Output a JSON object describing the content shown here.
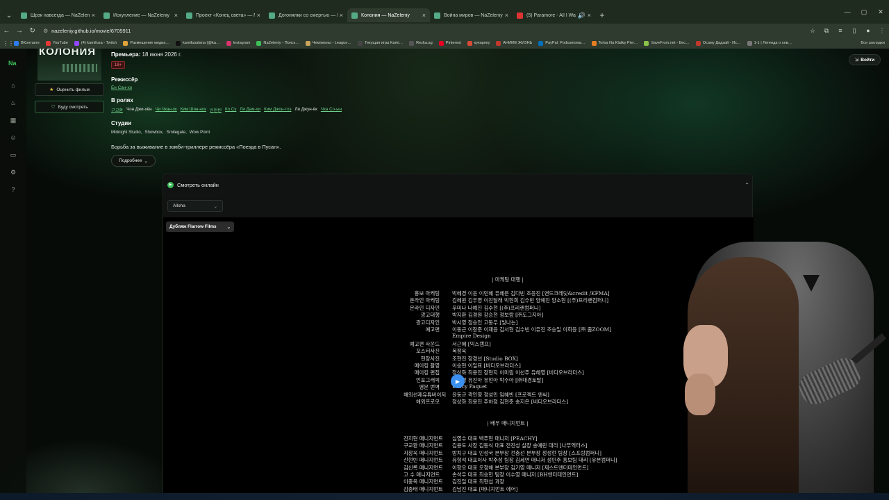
{
  "browser": {
    "tabs": [
      {
        "label": "Шрэк навсегда — NaZeleniy",
        "active": false
      },
      {
        "label": "Искупление — NaZeleniy",
        "active": false
      },
      {
        "label": "Проект «Конец света» — NaZ…",
        "active": false
      },
      {
        "label": "Догонялки со смертью — NaZ…",
        "active": false
      },
      {
        "label": "Колония — NaZeleniy",
        "active": true
      },
      {
        "label": "Война миров — NaZeleniy",
        "active": false
      },
      {
        "label": "(5) Paramore - All I Wanted",
        "active": false
      }
    ],
    "url": "nazeleniy.github.io/movie/6705911",
    "bookmarks": [
      {
        "label": "ВКонтакте",
        "color": "#2d7cf0"
      },
      {
        "label": "YouTube",
        "color": "#e53935"
      },
      {
        "label": "(4) kamifusa - Twitch",
        "color": "#9146ff"
      },
      {
        "label": "Размещение медиа…",
        "color": "#e0a33a"
      },
      {
        "label": "kamifusalana (@ka…",
        "color": "#111111"
      },
      {
        "label": "Instagram",
        "color": "#d6336c"
      },
      {
        "label": "NaZeleniy - Поиск…",
        "color": "#3fbf5a"
      },
      {
        "label": "Чемпионы - League…",
        "color": "#c9a45a"
      },
      {
        "label": "Текущая игра Kami…",
        "color": "#444444"
      },
      {
        "label": "Rezka.ag",
        "color": "#555555"
      },
      {
        "label": "Pinterest",
        "color": "#e60023"
      },
      {
        "label": "кукарекy",
        "color": "#d94a38"
      },
      {
        "label": "АНИМЕ ЖИЗНЬ",
        "color": "#c0392b"
      },
      {
        "label": "PayPal: Podsumowa…",
        "color": "#0070ba"
      },
      {
        "label": "Torba Na Klatkę Pier…",
        "color": "#e67e22"
      },
      {
        "label": "SaveFrom.net - Бес…",
        "color": "#8bc34a"
      },
      {
        "label": "Осаму Дадзай - Ис…",
        "color": "#c0392b"
      },
      {
        "label": "1-1 | Легенда о сев…",
        "color": "#777777"
      }
    ],
    "all_bookmarks": "Все закладки"
  },
  "sidebar": {
    "logo": "Na"
  },
  "share_label": "Войти",
  "movie": {
    "poster_title": "КОЛОНИЯ",
    "premiere_label": "Премьера:",
    "premiere_date": "18 июня 2026 г.",
    "age_rating": "18+",
    "rate_button": "Оценить фильм",
    "watchlist_button": "Буду смотреть",
    "director_heading": "Режиссёр",
    "director": "Ён Сан-хо",
    "cast_heading": "В ролях",
    "cast": [
      {
        "name": "구교환",
        "link": true
      },
      {
        "name": "Чон Джи-хён",
        "link": false
      },
      {
        "name": "Чи Чхан-ук",
        "link": true
      },
      {
        "name": "Ким Шин-нок",
        "link": true
      },
      {
        "name": "신현빈",
        "link": true
      },
      {
        "name": "Ко Су",
        "link": true
      },
      {
        "name": "Ли Дам-хи",
        "link": true
      },
      {
        "name": "Ким Джон-тхэ",
        "link": true
      },
      {
        "name": "Ли Джун-ёк",
        "link": false
      },
      {
        "name": "Чха Со-ын",
        "link": true
      }
    ],
    "studios_heading": "Студии",
    "studios": [
      "Midnight Studio,",
      "Showbox,",
      "Smilegate,",
      "Wow Point"
    ],
    "description": "Борьба за выживание в зомби-триллере режиссёра «Поезда в Пусан».",
    "more_button": "Подробнее"
  },
  "watch": {
    "heading": "Смотреть онлайн",
    "player_selected": "Alloha",
    "dub_selected": "Дубляж Flarrow Films"
  },
  "credits": {
    "section1": "|  마케팅 대행  |",
    "rows1": [
      {
        "role": "홍보 마케팅",
        "names": "박혜경 이윤 이민혜 유혜은 김다빈 조윤진 [앤드크레딧&credit /KFMA]"
      },
      {
        "role": "온라인 마케팅",
        "names": "김혜원 김우영 이진달래 박현희 김수빈 양예진 양소현 [(주)프리랜컴퍼니]"
      },
      {
        "role": "온라인 디자인",
        "names": "우미나 나예진 김수현 [(주)프리랜컴퍼니]"
      },
      {
        "role": "광고대행",
        "names": "박지환 김경원 강승현 정보람 [㈜도그지아]"
      },
      {
        "role": "광고디자인",
        "names": "박시영 정승인 고동우 [빛나는]"
      },
      {
        "role": "예고편",
        "names": "이동근 이창준 이재윤 김서현 김수빈 이유진 조승일 이희윤 [㈜ 줌ZOOM]"
      },
      {
        "role": "",
        "names": "Empire Design"
      },
      {
        "role": "예고편 사운드",
        "names": "서근혜 [믹스캠프]"
      },
      {
        "role": "포스터사진",
        "names": "목정욱"
      },
      {
        "role": "현장사진",
        "names": "조현진 장경선 [Studio BOX]"
      },
      {
        "role": "메이킹 촬영",
        "names": "이승현 이일표 [비디오브라더스]"
      },
      {
        "role": "메이킹 편집",
        "names": "정상화 최용진 장현지 이미림 이선주 유혜영 [비디오브라더스]"
      },
      {
        "role": "인포그래픽",
        "names": "구예경 유진아 유현아 박수아 [㈜대경토탈]"
      },
      {
        "role": "영문 번역",
        "names": "Darcy Paquet"
      },
      {
        "role": "해외선재유튜버이저",
        "names": "윤동규 곽인영 정성민 임혜빈 [프로젝트 앤씨]"
      },
      {
        "role": "해외프로모",
        "names": "정상화 최용진 주하정 김현준 송지은 [비디오브라더스]"
      }
    ],
    "section2": "|  배우 매니지먼트  |",
    "rows2": [
      {
        "role": "진지현 매니지먼트",
        "names": "심영수 대표 백주현 매니저 [PEACHY]"
      },
      {
        "role": "구교환 매니지먼트",
        "names": "김용도 사장 김동식 대표 전진성 실장 송예린 대리 [나무엑터스]"
      },
      {
        "role": "지창욱 매니지먼트",
        "names": "방치구 대표 민성국 본부장 전충선 본부장 정성현 팀장 [스프링컴퍼니]"
      },
      {
        "role": "신현빈 매니지먼트",
        "names": "유형석 대표이사 박주성 팀장 김세연 매니저 성민주 홍보팀 대리 [유본컴퍼니]"
      },
      {
        "role": "김신록 매니지먼트",
        "names": "이항오 대표 오정해 본부장 김기영 매니저 [제스트엔터테인먼트]"
      },
      {
        "role": "고 수 매니지먼트",
        "names": "손석우 대표 최승헌 팀장 이수영 매니저 [BH엔터테인먼트]"
      },
      {
        "role": "이중옥 매니지먼트",
        "names": "김진일 대표 최현섭 과장"
      },
      {
        "role": "김종태 매니지먼트",
        "names": "김남진 대표 [매니지먼트 에어]"
      }
    ]
  }
}
